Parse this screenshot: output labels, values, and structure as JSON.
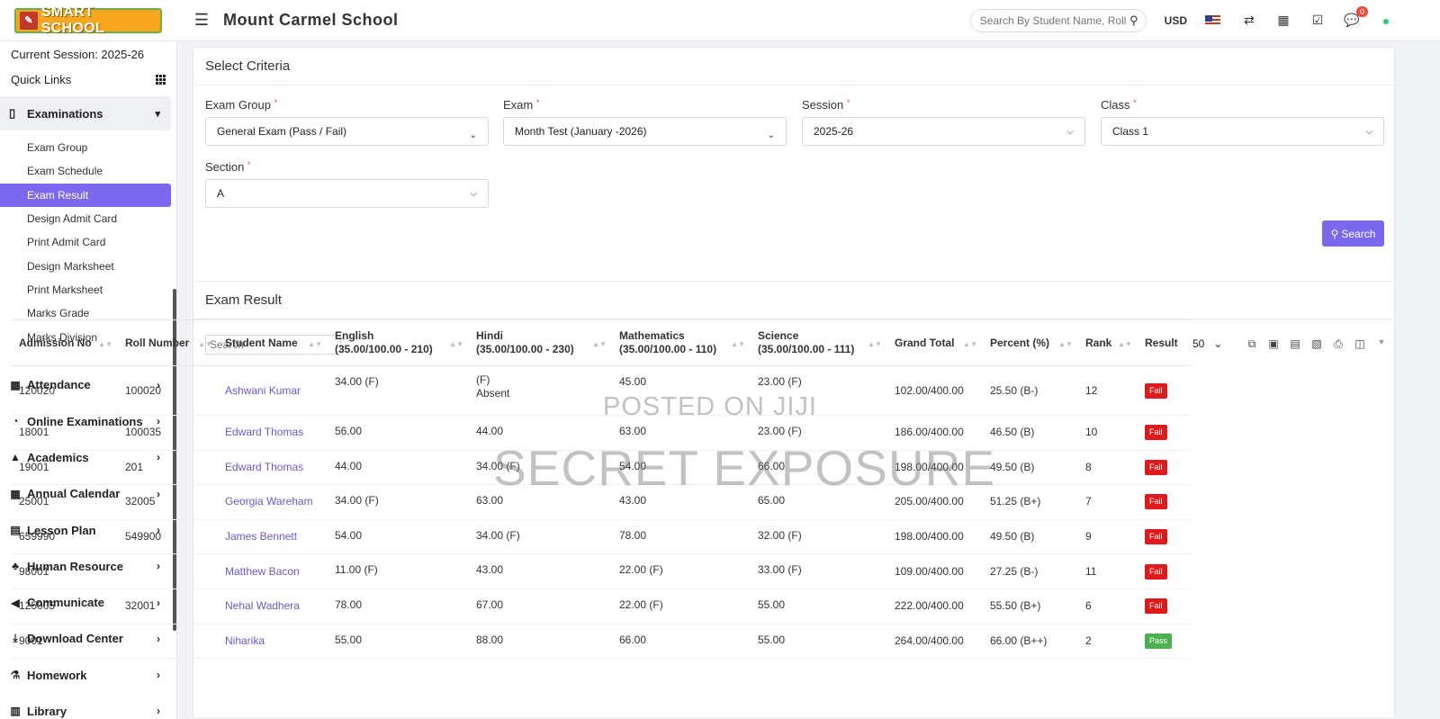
{
  "app": {
    "logo_text": "SMART SCHOOL",
    "school_name": "Mount Carmel School",
    "search_placeholder": "Search By Student Name, Roll Number",
    "currency": "USD",
    "notification_count": "0"
  },
  "sidebar": {
    "session": "Current Session: 2025-26",
    "quick_links": "Quick Links",
    "section_title": "Examinations",
    "sub_items": [
      "Exam Group",
      "Exam Schedule",
      "Exam Result",
      "Design Admit Card",
      "Print Admit Card",
      "Design Marksheet",
      "Print Marksheet",
      "Marks Grade",
      "Marks Division"
    ],
    "active_sub": "Exam Result",
    "nav_items": [
      "Attendance",
      "Online Examinations",
      "Academics",
      "Annual Calendar",
      "Lesson Plan",
      "Human Resource",
      "Communicate",
      "Download Center",
      "Homework",
      "Library"
    ]
  },
  "criteria": {
    "title": "Select Criteria",
    "exam_group_label": "Exam Group",
    "exam_group_value": "General Exam (Pass / Fail)",
    "exam_label": "Exam",
    "exam_value": "Month Test (January -2026)",
    "session_label": "Session",
    "session_value": "2025-26",
    "class_label": "Class",
    "class_value": "Class 1",
    "section_label": "Section",
    "section_value": "A",
    "search_button": "Search"
  },
  "result": {
    "title": "Exam Result",
    "search_placeholder": "Search",
    "per_page": "50",
    "columns": [
      "Admission No",
      "Roll Number",
      "Student Name",
      "English (35.00/100.00 - 210)",
      "Hindi (35.00/100.00 - 230)",
      "Mathematics (35.00/100.00 - 110)",
      "Science (35.00/100.00 - 111)",
      "Grand Total",
      "Percent (%)",
      "Rank",
      "Result"
    ],
    "col_english_1": "English",
    "col_english_2": "(35.00/100.00 - 210)",
    "col_hindi_1": "Hindi",
    "col_hindi_2": "(35.00/100.00 - 230)",
    "col_math_1": "Mathematics",
    "col_math_2": "(35.00/100.00 - 110)",
    "col_science_1": "Science",
    "col_science_2": "(35.00/100.00 - 111)",
    "rows": [
      {
        "adm": "120020",
        "roll": "100020",
        "name": "Ashwani Kumar",
        "english": "34.00 (F)",
        "hindi": "(F)",
        "hindi_note": "Absent",
        "math": "45.00",
        "science": "23.00 (F)",
        "total": "102.00/400.00",
        "percent": "25.50 (B-)",
        "rank": "12",
        "result": "Fail"
      },
      {
        "adm": "18001",
        "roll": "100035",
        "name": "Edward Thomas",
        "english": "56.00",
        "hindi": "44.00",
        "math": "63.00",
        "science": "23.00 (F)",
        "total": "186.00/400.00",
        "percent": "46.50 (B)",
        "rank": "10",
        "result": "Fail"
      },
      {
        "adm": "19001",
        "roll": "201",
        "name": "Edward Thomas",
        "english": "44.00",
        "hindi": "34.00 (F)",
        "math": "54.00",
        "science": "66.00",
        "total": "198.00/400.00",
        "percent": "49.50 (B)",
        "rank": "8",
        "result": "Fail"
      },
      {
        "adm": "25001",
        "roll": "32005",
        "name": "Georgia Wareham",
        "english": "34.00 (F)",
        "hindi": "63.00",
        "math": "43.00",
        "science": "65.00",
        "total": "205.00/400.00",
        "percent": "51.25 (B+)",
        "rank": "7",
        "result": "Fail"
      },
      {
        "adm": "659990",
        "roll": "549900",
        "name": "James Bennett",
        "english": "54.00",
        "hindi": "34.00 (F)",
        "math": "78.00",
        "science": "32.00 (F)",
        "total": "198.00/400.00",
        "percent": "49.50 (B)",
        "rank": "9",
        "result": "Fail"
      },
      {
        "adm": "98001",
        "roll": "",
        "name": "Matthew Bacon",
        "english": "11.00 (F)",
        "hindi": "43.00",
        "math": "22.00 (F)",
        "science": "33.00 (F)",
        "total": "109.00/400.00",
        "percent": "27.25 (B-)",
        "rank": "11",
        "result": "Fail"
      },
      {
        "adm": "125005",
        "roll": "32001",
        "name": "Nehal Wadhera",
        "english": "78.00",
        "hindi": "67.00",
        "math": "22.00 (F)",
        "science": "55.00",
        "total": "222.00/400.00",
        "percent": "55.50 (B+)",
        "rank": "6",
        "result": "Fail"
      },
      {
        "adm": "9001",
        "roll": "",
        "name": "Niharika",
        "english": "55.00",
        "hindi": "88.00",
        "math": "66.00",
        "science": "55.00",
        "total": "264.00/400.00",
        "percent": "66.00 (B++)",
        "rank": "2",
        "result": "Pass"
      }
    ]
  },
  "watermark": {
    "line1": "POSTED ON JIJI",
    "line2": "SECRET EXPOSURE"
  },
  "colors": {
    "accent": "#7b68ee",
    "fail": "#e01a1a",
    "pass": "#4caf50"
  }
}
